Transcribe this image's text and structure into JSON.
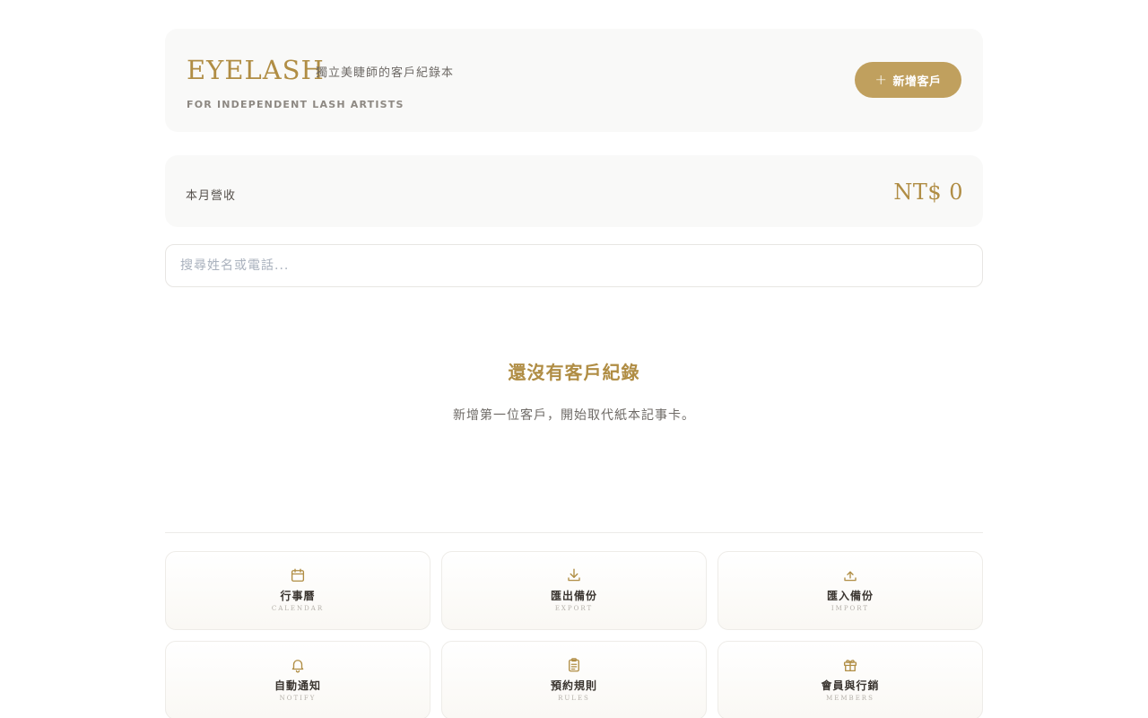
{
  "header": {
    "brand": "EYELASH",
    "subtitle": "獨立美睫師的客戶紀錄本",
    "tagline": "FOR INDEPENDENT LASH ARTISTS",
    "add_button": "新增客戶"
  },
  "revenue": {
    "label": "本月營收",
    "value": "NT$ 0"
  },
  "search": {
    "placeholder": "搜尋姓名或電話..."
  },
  "empty_state": {
    "title": "還沒有客戶紀錄",
    "description": "新增第一位客戶，開始取代紙本記事卡。"
  },
  "tiles": [
    {
      "label": "行事曆",
      "sub": "CALENDAR",
      "icon": "calendar-icon"
    },
    {
      "label": "匯出備份",
      "sub": "EXPORT",
      "icon": "download-icon"
    },
    {
      "label": "匯入備份",
      "sub": "IMPORT",
      "icon": "upload-icon"
    },
    {
      "label": "自動通知",
      "sub": "NOTIFY",
      "icon": "bell-icon"
    },
    {
      "label": "預約規則",
      "sub": "RULES",
      "icon": "clipboard-icon"
    },
    {
      "label": "會員與行銷",
      "sub": "MEMBERS",
      "icon": "gift-icon"
    }
  ],
  "colors": {
    "accent": "#b08d44",
    "button": "#c0a05e",
    "panel": "#f9f9f8"
  }
}
